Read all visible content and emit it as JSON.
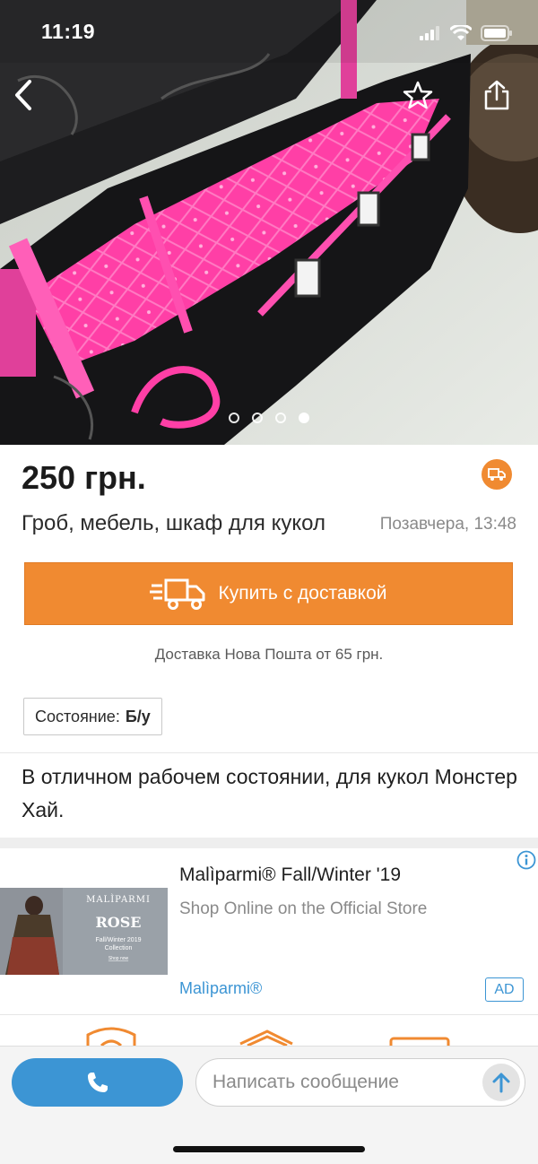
{
  "status_bar": {
    "time": "11:19"
  },
  "listing": {
    "price": "250 грн.",
    "title": "Гроб, мебель, шкаф для кукол",
    "date": "Позавчера, 13:48",
    "buy_button_label": "Купить с доставкой",
    "delivery_note": "Доставка Нова Пошта от 65 грн.",
    "condition_label": "Состояние:",
    "condition_value": "Б/у",
    "description": "В отличном рабочем состоянии, для кукол Монстер Хай.",
    "photo_count": 4,
    "active_photo": 4
  },
  "ad": {
    "title": "Malìparmi® Fall/Winter '19",
    "subtitle": "Shop Online on the Official Store",
    "brand": "Malìparmi®",
    "badge": "AD",
    "image_text": {
      "brand": "MALÌPARMI",
      "collection": "ROSE",
      "season": "Fall/Winter 2019",
      "label": "Collection",
      "cta": "Shop now"
    }
  },
  "bottom_bar": {
    "message_placeholder": "Написать сообщение"
  },
  "colors": {
    "accent_orange": "#f08a31",
    "accent_blue": "#3c95d4"
  },
  "icons": [
    "back-icon",
    "star-icon",
    "share-icon",
    "truck-icon",
    "info-icon",
    "phone-icon",
    "send-arrow-icon"
  ]
}
